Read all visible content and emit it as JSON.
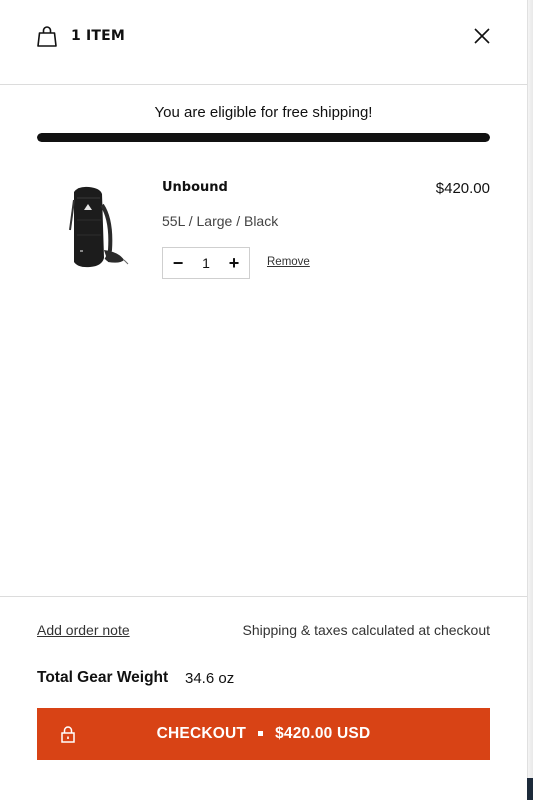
{
  "header": {
    "item_count": "1 ITEM"
  },
  "shipping": {
    "message": "You are eligible for free shipping!",
    "progress": 1.0
  },
  "cart": {
    "items": [
      {
        "name": "Unbound",
        "price": "$420.00",
        "variant": "55L / Large / Black",
        "quantity": "1",
        "minus_symbol": "−",
        "plus_symbol": "+",
        "remove_label": "Remove"
      }
    ]
  },
  "footer": {
    "order_note_label": "Add order note",
    "shipping_note": "Shipping & taxes calculated at checkout",
    "weight_label": "Total Gear Weight",
    "weight_value": "34.6 oz",
    "checkout_label": "CHECKOUT",
    "checkout_total": "$420.00 USD"
  },
  "colors": {
    "accent": "#d84315",
    "progress_fill": "#111111"
  },
  "icons": [
    "shopping-bag-icon",
    "close-icon",
    "lock-icon"
  ]
}
